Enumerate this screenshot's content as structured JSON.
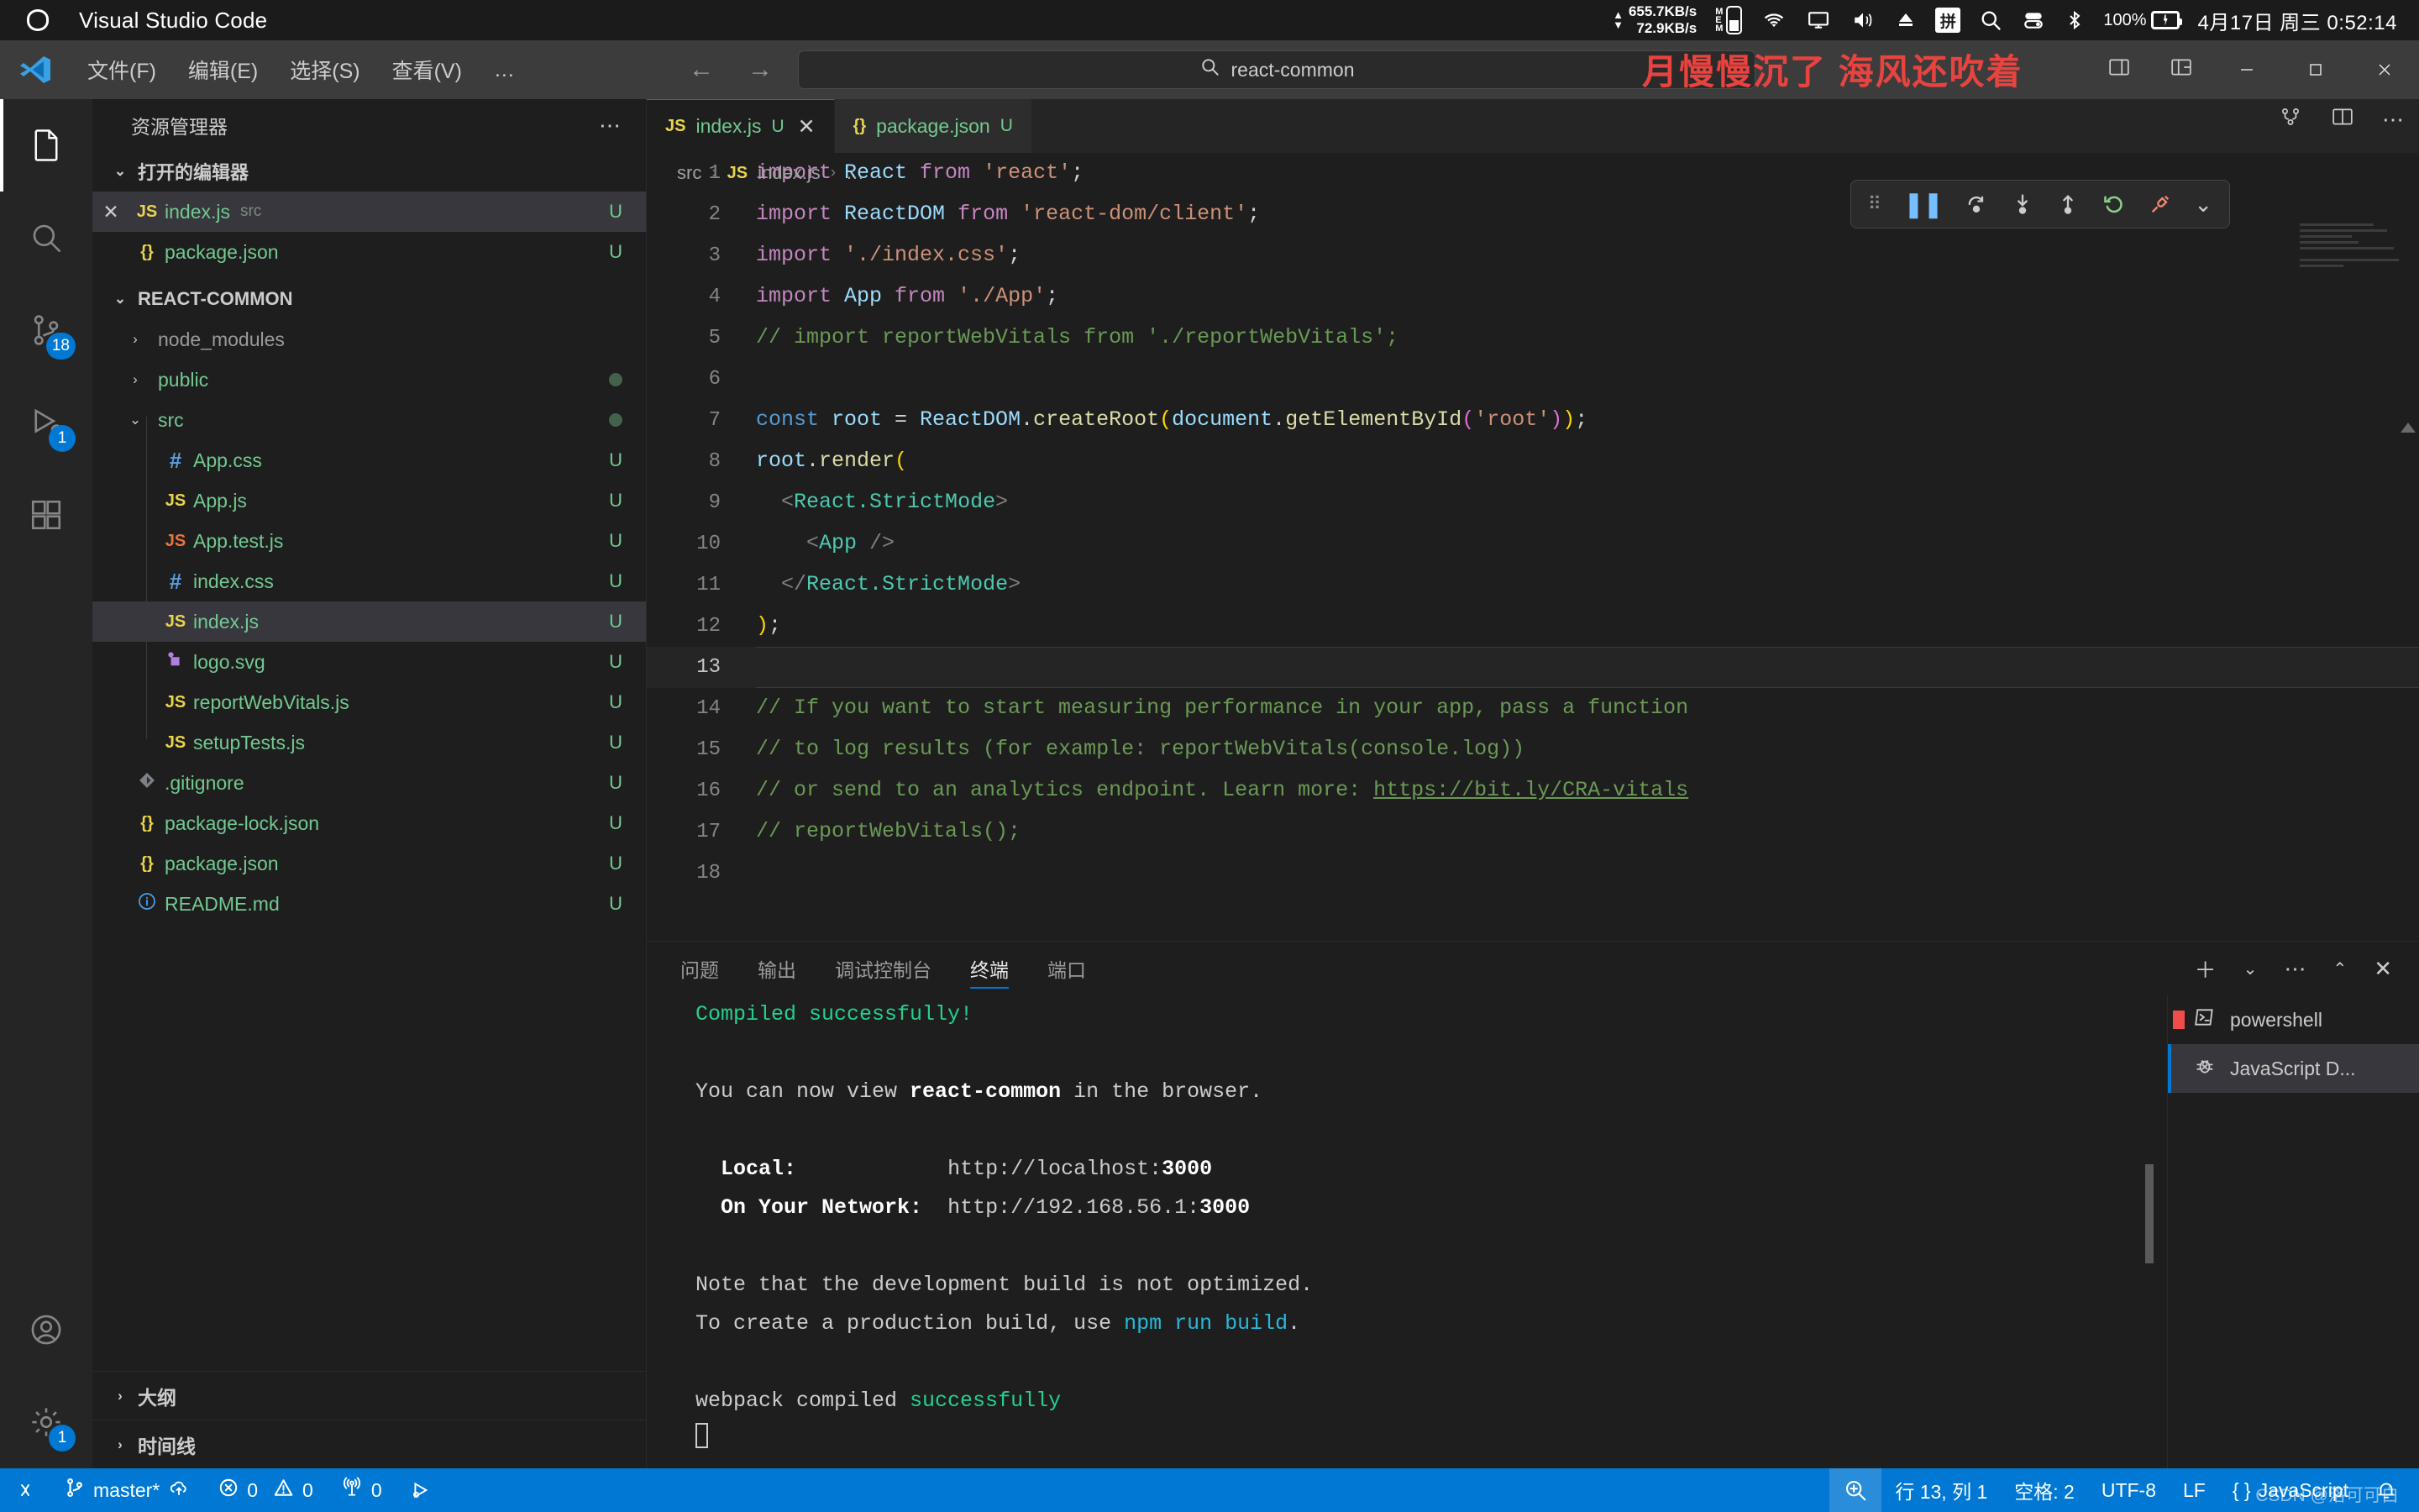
{
  "os_bar": {
    "app_title": "Visual Studio Code",
    "logo_icon": "circle-outline-icon",
    "net_up": "655.7KB/s",
    "net_down": "72.9KB/s",
    "mem_label": "MEM",
    "icons": [
      "phone-icon",
      "wifi-icon",
      "monitor-icon",
      "volume-icon",
      "eject-icon",
      "ime-pinyin-icon",
      "search-icon",
      "toggle-icon",
      "bluetooth-icon"
    ],
    "ime_label": "拼",
    "battery_percent": "100%",
    "clock": "4月17日 周三 0:52:14"
  },
  "titlebar": {
    "menus": [
      "文件(F)",
      "编辑(E)",
      "选择(S)",
      "查看(V)",
      "…"
    ],
    "nav_back": "←",
    "nav_forward": "→",
    "search_placeholder": "react-common",
    "search_icon": "search-icon",
    "window_buttons": [
      "minimize",
      "maximize",
      "close"
    ]
  },
  "overlay": {
    "red_text": "月慢慢沉了 海风还吹着"
  },
  "activity_bar": {
    "items": [
      {
        "name": "explorer",
        "icon": "files-icon",
        "badge": ""
      },
      {
        "name": "search",
        "icon": "search-icon",
        "badge": ""
      },
      {
        "name": "source-control",
        "icon": "source-control-icon",
        "badge": "18"
      },
      {
        "name": "run-and-debug",
        "icon": "run-debug-icon",
        "badge": "1"
      },
      {
        "name": "extensions",
        "icon": "extensions-icon",
        "badge": ""
      }
    ],
    "bottom_items": [
      {
        "name": "accounts",
        "icon": "account-icon",
        "badge": ""
      },
      {
        "name": "manage",
        "icon": "gear-icon",
        "badge": "1"
      }
    ]
  },
  "sidebar": {
    "title": "资源管理器",
    "more_icon": "ellipsis-icon",
    "open_editors": {
      "label": "打开的编辑器",
      "items": [
        {
          "name": "index.js",
          "sub": "src",
          "icon": "js-icon",
          "status": "U",
          "selected": true,
          "closable": true
        },
        {
          "name": "package.json",
          "sub": "",
          "icon": "json-icon",
          "status": "U",
          "selected": false,
          "closable": false
        }
      ]
    },
    "project": {
      "label": "REACT-COMMON",
      "items": [
        {
          "name": "node_modules",
          "type": "folder",
          "expanded": false,
          "icon": "chevron-right-icon",
          "status": "",
          "dot": false,
          "dim": true,
          "indent": 0
        },
        {
          "name": "public",
          "type": "folder",
          "expanded": false,
          "icon": "chevron-right-icon",
          "status": "",
          "dot": true,
          "dim": false,
          "indent": 0
        },
        {
          "name": "src",
          "type": "folder",
          "expanded": true,
          "icon": "chevron-down-icon",
          "status": "",
          "dot": true,
          "dim": false,
          "indent": 0
        },
        {
          "name": "App.css",
          "type": "file",
          "icon": "css-icon",
          "status": "U",
          "indent": 1
        },
        {
          "name": "App.js",
          "type": "file",
          "icon": "js-icon",
          "status": "U",
          "indent": 1
        },
        {
          "name": "App.test.js",
          "type": "file",
          "icon": "js-test-icon",
          "status": "U",
          "indent": 1
        },
        {
          "name": "index.css",
          "type": "file",
          "icon": "css-icon",
          "status": "U",
          "indent": 1
        },
        {
          "name": "index.js",
          "type": "file",
          "icon": "js-icon",
          "status": "U",
          "indent": 1,
          "selected": true
        },
        {
          "name": "logo.svg",
          "type": "file",
          "icon": "svg-icon",
          "status": "U",
          "indent": 1
        },
        {
          "name": "reportWebVitals.js",
          "type": "file",
          "icon": "js-icon",
          "status": "U",
          "indent": 1
        },
        {
          "name": "setupTests.js",
          "type": "file",
          "icon": "js-icon",
          "status": "U",
          "indent": 1
        },
        {
          "name": ".gitignore",
          "type": "file",
          "icon": "git-icon",
          "status": "U",
          "indent": 0
        },
        {
          "name": "package-lock.json",
          "type": "file",
          "icon": "json-icon",
          "status": "U",
          "indent": 0
        },
        {
          "name": "package.json",
          "type": "file",
          "icon": "json-icon",
          "status": "U",
          "indent": 0
        },
        {
          "name": "README.md",
          "type": "file",
          "icon": "md-icon",
          "status": "U",
          "indent": 0
        }
      ]
    },
    "outline_label": "大纲",
    "timeline_label": "时间线"
  },
  "editor": {
    "tabs": [
      {
        "name": "index.js",
        "icon": "js-icon",
        "status": "U",
        "active": true,
        "close_icon": "close-icon"
      },
      {
        "name": "package.json",
        "icon": "json-icon",
        "status": "U",
        "active": false,
        "close_icon": ""
      }
    ],
    "breadcrumb": [
      "src",
      "index.js",
      "…"
    ],
    "breadcrumb_file_icon": "js-icon",
    "actions": [
      "split-editor-icon",
      "layout-icon",
      "more-actions-icon",
      "diff-icon"
    ],
    "debug_toolbar": {
      "icons": [
        "grip-icon",
        "pause-icon",
        "step-over-icon",
        "step-into-icon",
        "step-out-icon",
        "restart-icon",
        "disconnect-icon",
        "chevron-down-icon"
      ]
    },
    "lines": [
      {
        "n": "1",
        "tokens": [
          {
            "t": "import ",
            "c": "kw"
          },
          {
            "t": "React",
            "c": "var"
          },
          {
            "t": " from ",
            "c": "kw"
          },
          {
            "t": "'react'",
            "c": "str"
          },
          {
            "t": ";",
            "c": "pun"
          }
        ]
      },
      {
        "n": "2",
        "tokens": [
          {
            "t": "import ",
            "c": "kw"
          },
          {
            "t": "ReactDOM",
            "c": "var"
          },
          {
            "t": " from ",
            "c": "kw"
          },
          {
            "t": "'react-dom/client'",
            "c": "str"
          },
          {
            "t": ";",
            "c": "pun"
          }
        ]
      },
      {
        "n": "3",
        "tokens": [
          {
            "t": "import ",
            "c": "kw"
          },
          {
            "t": "'./index.css'",
            "c": "str"
          },
          {
            "t": ";",
            "c": "pun"
          }
        ]
      },
      {
        "n": "4",
        "tokens": [
          {
            "t": "import ",
            "c": "kw"
          },
          {
            "t": "App",
            "c": "var"
          },
          {
            "t": " from ",
            "c": "kw"
          },
          {
            "t": "'./App'",
            "c": "str"
          },
          {
            "t": ";",
            "c": "pun"
          }
        ]
      },
      {
        "n": "5",
        "tokens": [
          {
            "t": "// import reportWebVitals from './reportWebVitals';",
            "c": "cmt"
          }
        ]
      },
      {
        "n": "6",
        "tokens": []
      },
      {
        "n": "7",
        "tokens": [
          {
            "t": "const ",
            "c": "bl"
          },
          {
            "t": "root",
            "c": "var"
          },
          {
            "t": " = ",
            "c": "pun"
          },
          {
            "t": "ReactDOM",
            "c": "var"
          },
          {
            "t": ".",
            "c": "pun"
          },
          {
            "t": "createRoot",
            "c": "fn"
          },
          {
            "t": "(",
            "c": "par-y"
          },
          {
            "t": "document",
            "c": "var"
          },
          {
            "t": ".",
            "c": "pun"
          },
          {
            "t": "getElementById",
            "c": "fn"
          },
          {
            "t": "(",
            "c": "par-p"
          },
          {
            "t": "'root'",
            "c": "str"
          },
          {
            "t": ")",
            "c": "par-p"
          },
          {
            "t": ")",
            "c": "par-y"
          },
          {
            "t": ";",
            "c": "pun"
          }
        ]
      },
      {
        "n": "8",
        "tokens": [
          {
            "t": "root",
            "c": "var"
          },
          {
            "t": ".",
            "c": "pun"
          },
          {
            "t": "render",
            "c": "fn"
          },
          {
            "t": "(",
            "c": "par-y"
          }
        ]
      },
      {
        "n": "9",
        "tokens": [
          {
            "t": "  ",
            "c": "pun"
          },
          {
            "t": "<",
            "c": "brk"
          },
          {
            "t": "React.StrictMode",
            "c": "tag"
          },
          {
            "t": ">",
            "c": "brk"
          }
        ]
      },
      {
        "n": "10",
        "tokens": [
          {
            "t": "    ",
            "c": "pun"
          },
          {
            "t": "<",
            "c": "brk"
          },
          {
            "t": "App",
            "c": "tag"
          },
          {
            "t": " />",
            "c": "brk"
          }
        ]
      },
      {
        "n": "11",
        "tokens": [
          {
            "t": "  ",
            "c": "pun"
          },
          {
            "t": "</",
            "c": "brk"
          },
          {
            "t": "React.StrictMode",
            "c": "tag"
          },
          {
            "t": ">",
            "c": "brk"
          }
        ]
      },
      {
        "n": "12",
        "tokens": [
          {
            "t": ")",
            "c": "par-y"
          },
          {
            "t": ";",
            "c": "pun"
          }
        ]
      },
      {
        "n": "13",
        "tokens": [],
        "current": true
      },
      {
        "n": "14",
        "tokens": [
          {
            "t": "// If you want to start measuring performance in your app, pass a function",
            "c": "cmt"
          }
        ]
      },
      {
        "n": "15",
        "tokens": [
          {
            "t": "// to log results (for example: reportWebVitals(console.log))",
            "c": "cmt"
          }
        ]
      },
      {
        "n": "16",
        "tokens": [
          {
            "t": "// or send to an analytics endpoint. Learn more: ",
            "c": "cmt"
          },
          {
            "t": "https://bit.ly/CRA-vitals",
            "c": "link"
          }
        ]
      },
      {
        "n": "17",
        "tokens": [
          {
            "t": "// reportWebVitals();",
            "c": "cmt"
          }
        ]
      },
      {
        "n": "18",
        "tokens": []
      }
    ]
  },
  "panel": {
    "tabs": [
      "问题",
      "输出",
      "调试控制台",
      "终端",
      "端口"
    ],
    "active_tab": "终端",
    "actions": [
      "add-terminal-icon",
      "chevron-down-icon",
      "more-actions-icon",
      "chevron-up-icon",
      "chevron-down-icon",
      "close-icon"
    ],
    "terminal_lines": [
      {
        "segs": [
          {
            "t": "Compiled successfully!",
            "c": "tgreen"
          }
        ]
      },
      {
        "segs": []
      },
      {
        "segs": [
          {
            "t": "You can now view ",
            "c": ""
          },
          {
            "t": "react-common",
            "c": "tbold"
          },
          {
            "t": " in the browser.",
            "c": ""
          }
        ]
      },
      {
        "segs": []
      },
      {
        "segs": [
          {
            "t": "  Local:            ",
            "c": "tbold"
          },
          {
            "t": "http://localhost:",
            "c": ""
          },
          {
            "t": "3000",
            "c": "tbold"
          }
        ]
      },
      {
        "segs": [
          {
            "t": "  On Your Network:  ",
            "c": "tbold"
          },
          {
            "t": "http://192.168.56.1:",
            "c": ""
          },
          {
            "t": "3000",
            "c": "tbold"
          }
        ]
      },
      {
        "segs": []
      },
      {
        "segs": [
          {
            "t": "Note that the development build is not optimized.",
            "c": ""
          }
        ]
      },
      {
        "segs": [
          {
            "t": "To create a production build, use ",
            "c": ""
          },
          {
            "t": "npm run build",
            "c": "tcyan"
          },
          {
            "t": ".",
            "c": ""
          }
        ]
      },
      {
        "segs": []
      },
      {
        "segs": [
          {
            "t": "webpack compiled ",
            "c": ""
          },
          {
            "t": "successfully",
            "c": "tgreen"
          }
        ]
      }
    ],
    "terminal_list": [
      {
        "label": "powershell",
        "icon": "terminal-icon",
        "active": false,
        "marker": true
      },
      {
        "label": "JavaScript D...",
        "icon": "debug-bug-icon",
        "active": true,
        "marker": false
      }
    ]
  },
  "statusbar": {
    "remote_icon": "remote-icon",
    "branch_icon": "source-control-icon",
    "branch": "master*",
    "sync_icon": "cloud-upload-icon",
    "error_icon": "error-circle-icon",
    "errors": "0",
    "warning_icon": "warning-triangle-icon",
    "warnings": "0",
    "radio_icon": "radio-tower-icon",
    "ports": "0",
    "debug_icon": "debug-alt-icon",
    "zoom_icon": "zoom-in-icon",
    "cursor_position": "行 13, 列 1",
    "indent": "空格: 2",
    "encoding": "UTF-8",
    "eol": "LF",
    "language": "JavaScript",
    "language_icon": "json-braces-icon",
    "bell_icon": "bell-icon",
    "watermark": "CSDN @洛可可白"
  },
  "colors": {
    "accent": "#0078d4",
    "bg": "#1e1e1e",
    "titlebar": "#3c3c3c",
    "sidebar": "#1e1e1e",
    "green": "#73c991",
    "red_overlay": "#e8433f"
  }
}
